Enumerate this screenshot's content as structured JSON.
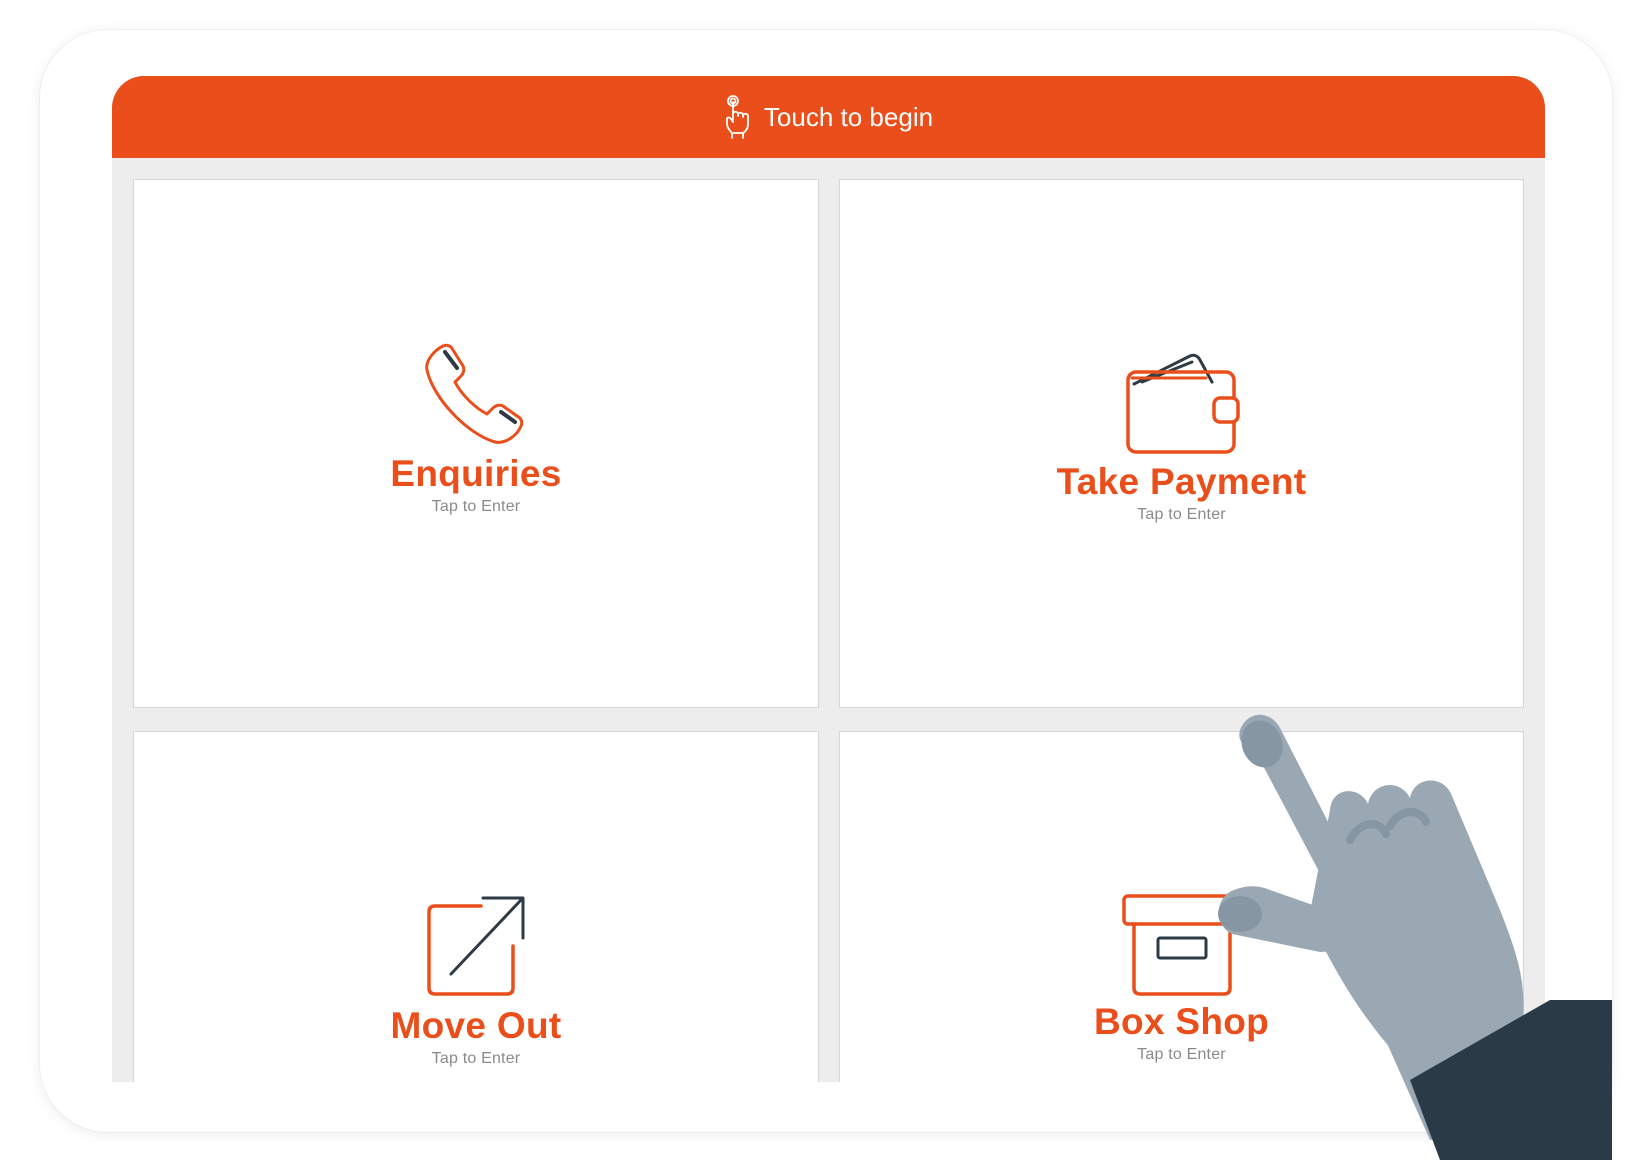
{
  "header": {
    "title": "Touch to begin",
    "icon": "touch-hand-icon"
  },
  "tiles": [
    {
      "label": "Enquiries",
      "sub": "Tap to Enter",
      "icon": "phone-icon"
    },
    {
      "label": "Take Payment",
      "sub": "Tap to Enter",
      "icon": "wallet-icon"
    },
    {
      "label": "Move Out",
      "sub": "Tap to Enter",
      "icon": "external-arrow-icon"
    },
    {
      "label": "Box Shop",
      "sub": "Tap to Enter",
      "icon": "box-icon"
    }
  ],
  "colors": {
    "accent": "#e94e1b",
    "icon_dark": "#2e3b44",
    "background": "#ededed",
    "hand": "#9aa8b3",
    "sleeve": "#2a3a46"
  }
}
